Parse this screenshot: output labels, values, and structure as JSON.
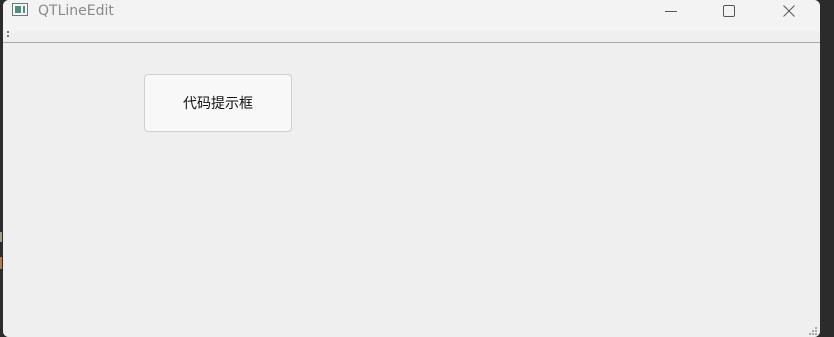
{
  "window": {
    "title": "QTLineEdit"
  },
  "main": {
    "button_label": "代码提示框"
  },
  "icons": {
    "app": "qt-window-icon",
    "minimize": "minimize-icon",
    "maximize": "maximize-icon",
    "close": "close-icon",
    "grip": "size-grip-icon"
  },
  "colors": {
    "window_bg": "#efefef",
    "titlebar_bg": "#f3f3f3",
    "title_text": "#8a8a8a",
    "button_bg": "#f8f8f8",
    "button_border": "#cfcfcf"
  }
}
